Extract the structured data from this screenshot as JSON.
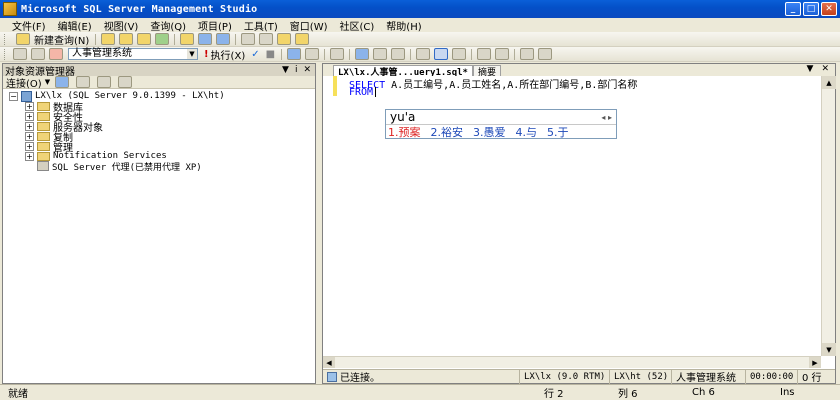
{
  "window": {
    "title": "Microsoft SQL Server Management Studio"
  },
  "menu": [
    "文件(F)",
    "编辑(E)",
    "视图(V)",
    "查询(Q)",
    "项目(P)",
    "工具(T)",
    "窗口(W)",
    "社区(C)",
    "帮助(H)"
  ],
  "toolbar": {
    "new_query": "新建查询(N)",
    "database": "人事管理系统",
    "execute": "执行(X)"
  },
  "object_explorer": {
    "title": "对象资源管理器",
    "connect": "连接(O)",
    "server": "LX\\lx (SQL Server 9.0.1399 - LX\\ht)",
    "nodes": [
      "数据库",
      "安全性",
      "服务器对象",
      "复制",
      "管理",
      "Notification Services"
    ],
    "agent": "SQL Server 代理(已禁用代理 XP)"
  },
  "editor": {
    "tab_active": "LX\\lx.人事管...uery1.sql*",
    "tab_summary": "摘要",
    "code": {
      "select_kw": "SELECT",
      "select_rest": " A.员工编号,A.员工姓名,A.所在部门编号,B.部门名称",
      "from_kw": "FROM"
    },
    "ime": {
      "composition": "yu'a",
      "candidates": [
        "1.预案",
        "2.裕安",
        "3.愚爱",
        "4.与",
        "5.于"
      ]
    }
  },
  "query_status": {
    "connected": "已连接。",
    "server": "LX\\lx (9.0 RTM)",
    "user": "LX\\ht (52)",
    "database": "人事管理系统",
    "time": "00:00:00",
    "rows": "0 行"
  },
  "statusbar": {
    "ready": "就绪",
    "line": "行 2",
    "col": "列 6",
    "ch": "Ch 6",
    "mode": "Ins"
  }
}
